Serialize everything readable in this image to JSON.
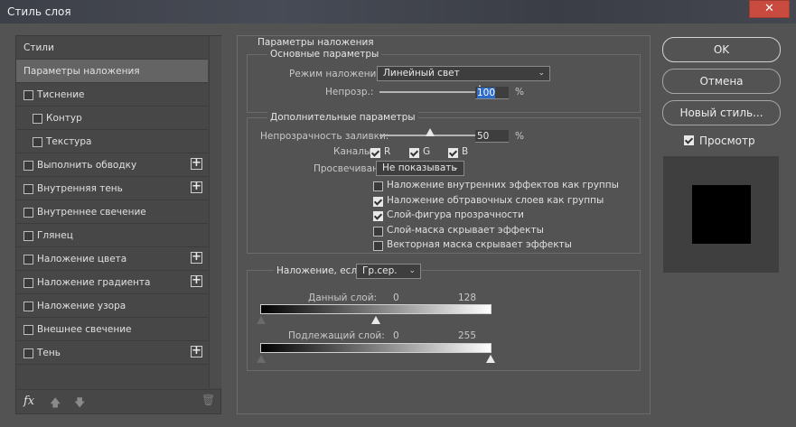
{
  "window": {
    "title": "Стиль слоя",
    "close_glyph": "✕"
  },
  "styles_panel": {
    "items": [
      {
        "label": "Стили",
        "checkbox": false,
        "checked": false,
        "indent": 0,
        "plus": false,
        "selected": false
      },
      {
        "label": "Параметры наложения",
        "checkbox": false,
        "checked": false,
        "indent": 0,
        "plus": false,
        "selected": true
      },
      {
        "label": "Тиснение",
        "checkbox": true,
        "checked": false,
        "indent": 0,
        "plus": false,
        "selected": false
      },
      {
        "label": "Контур",
        "checkbox": true,
        "checked": false,
        "indent": 1,
        "plus": false,
        "selected": false
      },
      {
        "label": "Текстура",
        "checkbox": true,
        "checked": false,
        "indent": 1,
        "plus": false,
        "selected": false
      },
      {
        "label": "Выполнить обводку",
        "checkbox": true,
        "checked": false,
        "indent": 0,
        "plus": true,
        "selected": false
      },
      {
        "label": "Внутренняя тень",
        "checkbox": true,
        "checked": false,
        "indent": 0,
        "plus": true,
        "selected": false
      },
      {
        "label": "Внутреннее свечение",
        "checkbox": true,
        "checked": false,
        "indent": 0,
        "plus": false,
        "selected": false
      },
      {
        "label": "Глянец",
        "checkbox": true,
        "checked": false,
        "indent": 0,
        "plus": false,
        "selected": false
      },
      {
        "label": "Наложение цвета",
        "checkbox": true,
        "checked": false,
        "indent": 0,
        "plus": true,
        "selected": false
      },
      {
        "label": "Наложение градиента",
        "checkbox": true,
        "checked": false,
        "indent": 0,
        "plus": true,
        "selected": false
      },
      {
        "label": "Наложение узора",
        "checkbox": true,
        "checked": false,
        "indent": 0,
        "plus": false,
        "selected": false
      },
      {
        "label": "Внешнее свечение",
        "checkbox": true,
        "checked": false,
        "indent": 0,
        "plus": false,
        "selected": false
      },
      {
        "label": "Тень",
        "checkbox": true,
        "checked": false,
        "indent": 0,
        "plus": true,
        "selected": false
      }
    ],
    "footer": {
      "fx_label": "fx",
      "up_glyph": "🡅",
      "down_glyph": "🡇",
      "trash_glyph": "🗑"
    }
  },
  "blending": {
    "section_title": "Параметры наложения",
    "general": {
      "title": "Основные параметры",
      "mode_label": "Режим наложения:",
      "mode_value": "Линейный свет",
      "opacity_label": "Непрозр.:",
      "opacity_value": "100",
      "opacity_fraction": 1.0,
      "percent": "%"
    },
    "advanced": {
      "title": "Дополнительные параметры",
      "fill_label": "Непрозрачность заливки:",
      "fill_value": "50",
      "fill_fraction": 0.5,
      "percent": "%",
      "channels_label": "Каналы:",
      "channels": [
        {
          "label": "R",
          "checked": true
        },
        {
          "label": "G",
          "checked": true
        },
        {
          "label": "B",
          "checked": true
        }
      ],
      "knockout_label": "Просвечивание:",
      "knockout_value": "Не показывать",
      "options": [
        {
          "label": "Наложение внутренних эффектов как группы",
          "checked": false
        },
        {
          "label": "Наложение обтравочных слоев как группы",
          "checked": true
        },
        {
          "label": "Слой-фигура прозрачности",
          "checked": true
        },
        {
          "label": "Слой-маска скрывает эффекты",
          "checked": false
        },
        {
          "label": "Векторная маска скрывает эффекты",
          "checked": false
        }
      ]
    },
    "blend_if": {
      "label": "Наложение, если:",
      "value": "Гр.сер.",
      "this_layer_label": "Данный слой:",
      "this_layer_min": "0",
      "this_layer_max": "128",
      "this_layer_min_value": 0,
      "this_layer_max_value": 128,
      "underlying_label": "Подлежащий слой:",
      "underlying_min": "0",
      "underlying_max": "255",
      "underlying_min_value": 0,
      "underlying_max_value": 255
    }
  },
  "buttons": {
    "ok": "OK",
    "cancel": "Отмена",
    "new_style": "Новый стиль...",
    "preview_label": "Просмотр",
    "preview_checked": true
  },
  "colors": {
    "background": "#535353",
    "selection": "#2d6bc9",
    "close_button": "#c94b3f"
  }
}
